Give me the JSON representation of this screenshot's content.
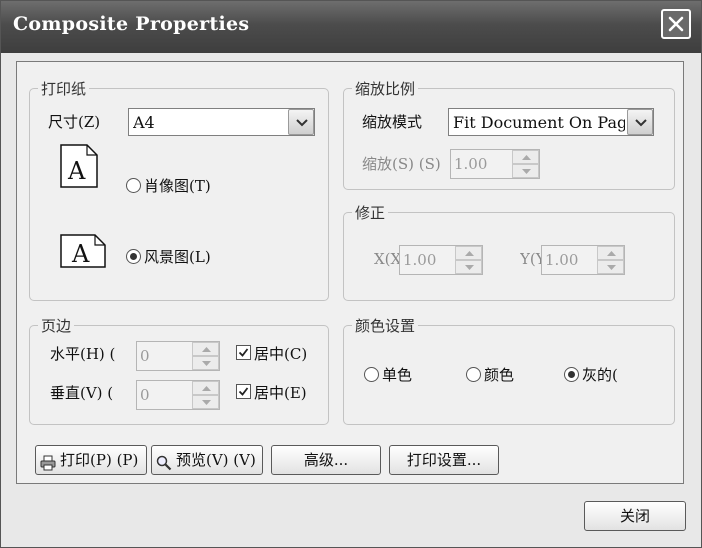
{
  "window": {
    "title": "Composite Properties"
  },
  "paper": {
    "title": "打印纸",
    "size_label": "尺寸(Z)",
    "size_value": "A4",
    "portrait_icon_letter": "A",
    "portrait_label": "肖像图(T)",
    "landscape_icon_letter": "A",
    "landscape_label": "风景图(L)",
    "orientation_selected": "landscape"
  },
  "scale": {
    "title": "缩放比例",
    "mode_label": "缩放模式",
    "mode_value": "Fit Document On Page",
    "scale_label": "缩放(S) (S)",
    "scale_value": "1.00"
  },
  "correction": {
    "title": "修正",
    "x_label": "X(X)",
    "x_value": "1.00",
    "y_label": "Y(Y)",
    "y_value": "1.00"
  },
  "margins": {
    "title": "页边",
    "horizontal_label": "水平(H) (",
    "horizontal_value": "0",
    "horizontal_center_label": "居中(C)",
    "vertical_label": "垂直(V) (",
    "vertical_value": "0",
    "vertical_center_label": "居中(E)"
  },
  "color": {
    "title": "颜色设置",
    "mono_label": "单色",
    "color_label": "颜色",
    "gray_label": "灰的(",
    "selected": "gray"
  },
  "buttons": {
    "print": "打印(P) (P)",
    "preview": "预览(V) (V)",
    "advanced": "高级...",
    "print_setup": "打印设置..."
  },
  "footer": {
    "close": "关闭"
  },
  "icons": {
    "close": "close-icon",
    "print": "printer-icon",
    "preview": "magnifier-icon",
    "dropdown": "chevron-down-icon",
    "spin_up": "spin-up-icon",
    "spin_down": "spin-down-icon",
    "check": "checkmark-icon"
  }
}
